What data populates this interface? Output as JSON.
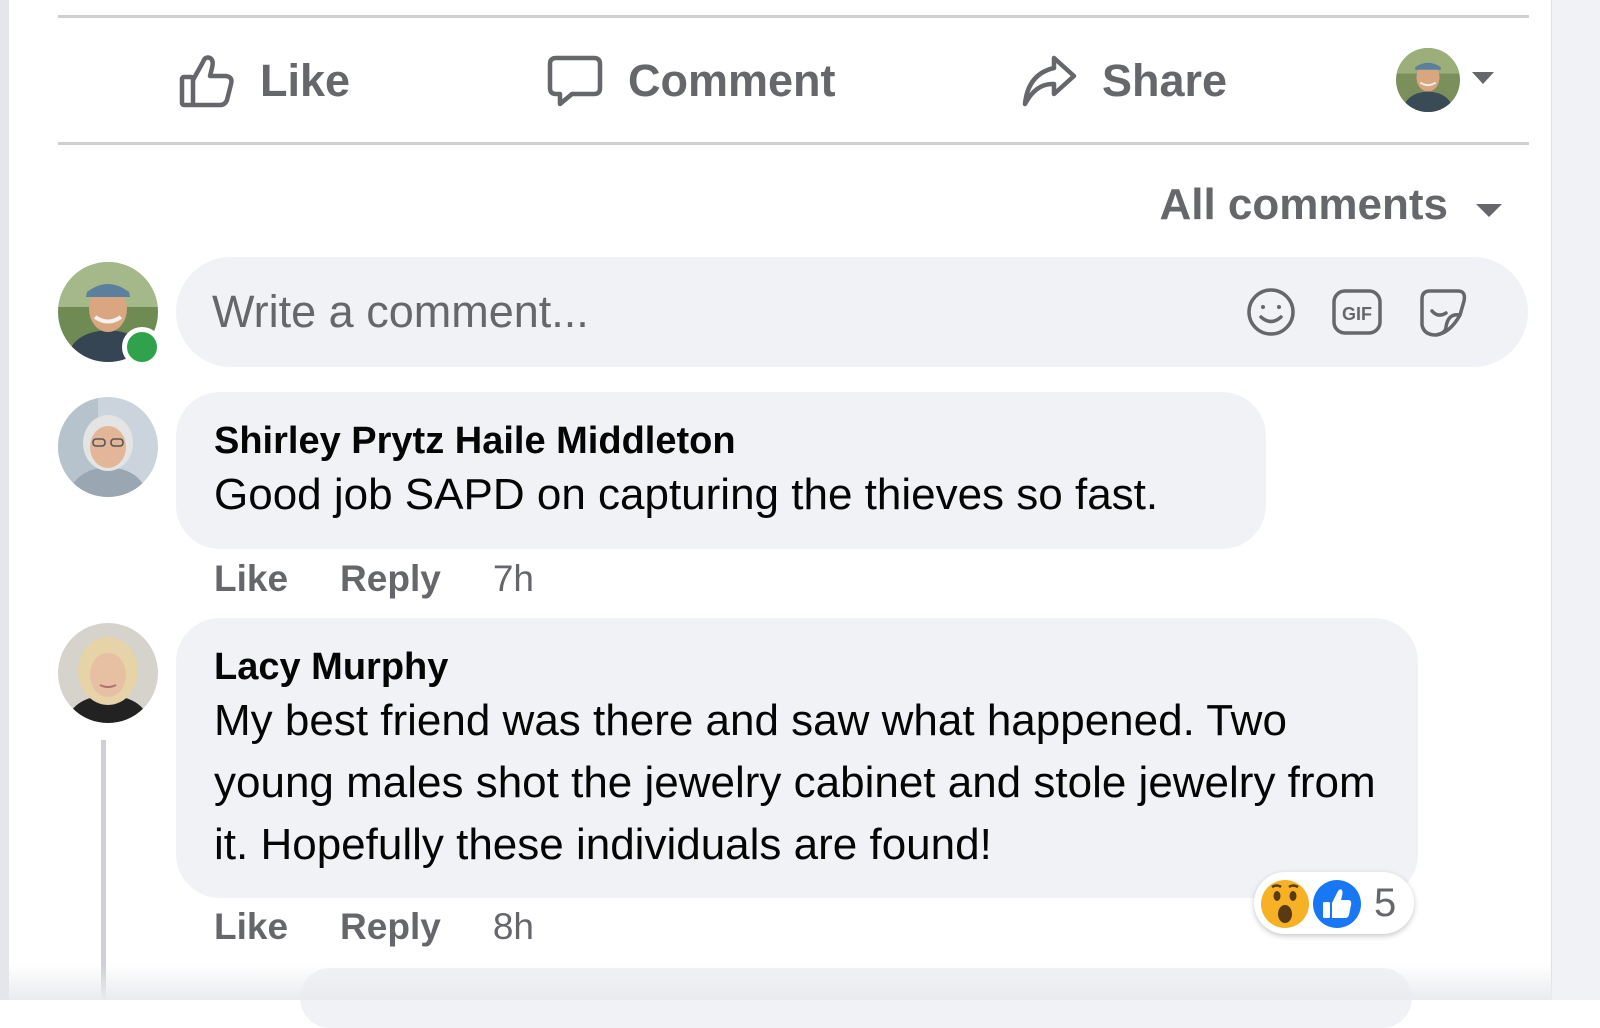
{
  "post_actions": {
    "like_label": "Like",
    "comment_label": "Comment",
    "share_label": "Share"
  },
  "comment_sort": {
    "label": "All comments"
  },
  "composer": {
    "placeholder": "Write a comment..."
  },
  "comments": [
    {
      "author": "Shirley Prytz Haile Middleton",
      "text": "Good job SAPD on capturing the thieves so fast.",
      "like_label": "Like",
      "reply_label": "Reply",
      "time": "7h"
    },
    {
      "author": "Lacy Murphy",
      "text": "My best friend was there and saw what happened. Two young males shot the jewelry cabinet and stole jewelry from it. Hopefully these individuals are found!",
      "like_label": "Like",
      "reply_label": "Reply",
      "time": "8h",
      "reactions": {
        "icons": [
          "wow-reaction-icon",
          "like-reaction-icon"
        ],
        "count": "5"
      }
    }
  ],
  "colors": {
    "secondary_text": "#65676b",
    "bubble_bg": "#f0f2f5",
    "online": "#31a24c",
    "like_blue": "#1877f2",
    "wow_yellow": "#f7b125"
  }
}
